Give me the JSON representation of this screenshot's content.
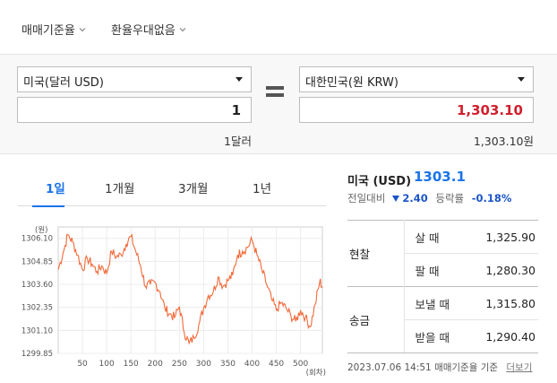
{
  "options": {
    "basis_label": "매매기준율",
    "preferential_label": "환율우대없음"
  },
  "converter": {
    "from_currency": "미국(달러 USD)",
    "to_currency": "대한민국(원 KRW)",
    "from_amount": "1",
    "to_amount": "1,303.10",
    "from_unit_text": "1달러",
    "to_unit_text": "1,303.10원",
    "to_amount_color": "#d0202e"
  },
  "tabs": [
    "1일",
    "1개월",
    "3개월",
    "1년"
  ],
  "summary": {
    "name": "미국 (USD)",
    "price": "1303.1",
    "compare_label": "전일대비",
    "change": "2.40",
    "rate_label": "등락률",
    "rate": "-0.18%"
  },
  "rates": {
    "cash_label": "현찰",
    "buy_label": "살 때",
    "buy_value": "1,325.90",
    "sell_label": "팔 때",
    "sell_value": "1,280.30",
    "transfer_label": "송금",
    "send_label": "보낼 때",
    "send_value": "1,315.80",
    "receive_label": "받을 때",
    "receive_value": "1,290.40"
  },
  "footer": {
    "timestamp": "2023.07.06 14:51",
    "basis_text": "매매기준율 기준",
    "more_label": "더보기"
  },
  "chart_data": {
    "type": "line",
    "ylabel": "(원)",
    "xlabel": "(회차)",
    "yticks": [
      "1306.10",
      "1304.85",
      "1303.60",
      "1302.35",
      "1301.10",
      "1299.85"
    ],
    "xticks": [
      "50",
      "100",
      "150",
      "200",
      "250",
      "300",
      "350",
      "400",
      "450",
      "500"
    ],
    "xlim": [
      0,
      545
    ],
    "ylim": [
      1299.85,
      1306.72
    ],
    "line_color": "#f26a3a",
    "x": [
      0,
      10,
      20,
      30,
      40,
      50,
      60,
      70,
      80,
      90,
      100,
      110,
      120,
      130,
      140,
      150,
      160,
      170,
      180,
      190,
      200,
      210,
      220,
      230,
      240,
      250,
      260,
      270,
      280,
      290,
      300,
      310,
      320,
      330,
      340,
      350,
      360,
      370,
      380,
      390,
      400,
      410,
      420,
      430,
      440,
      450,
      460,
      470,
      480,
      490,
      500,
      510,
      520,
      530,
      540,
      545
    ],
    "y": [
      1304.4,
      1305.3,
      1306.3,
      1305.9,
      1305.2,
      1304.4,
      1305.0,
      1304.7,
      1304.3,
      1304.6,
      1304.2,
      1305.4,
      1305.1,
      1305.2,
      1305.8,
      1306.2,
      1305.4,
      1304.6,
      1303.5,
      1303.6,
      1303.7,
      1303.2,
      1302.3,
      1302.0,
      1301.8,
      1302.4,
      1301.0,
      1300.4,
      1300.7,
      1301.4,
      1302.3,
      1303.0,
      1303.2,
      1304.0,
      1303.5,
      1303.8,
      1304.1,
      1305.2,
      1305.4,
      1305.6,
      1306.0,
      1305.2,
      1304.4,
      1303.6,
      1302.8,
      1302.2,
      1302.6,
      1302.3,
      1301.9,
      1301.6,
      1302.2,
      1301.8,
      1301.3,
      1302.5,
      1303.8,
      1303.4
    ]
  }
}
